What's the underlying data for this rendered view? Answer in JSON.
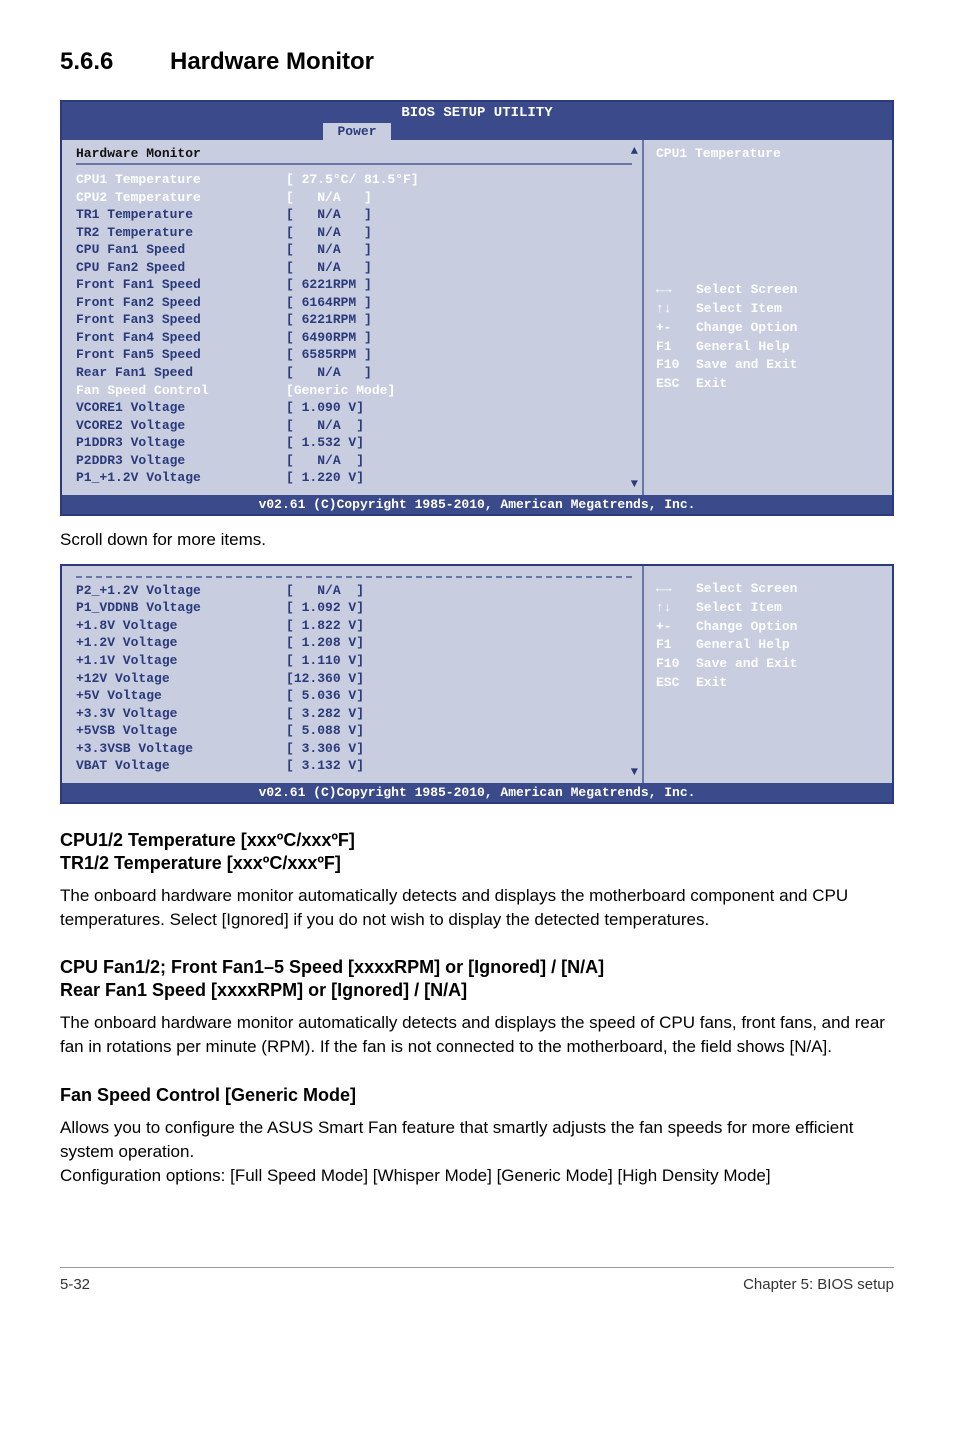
{
  "section": {
    "number": "5.6.6",
    "title": "Hardware Monitor"
  },
  "bios": {
    "title": "BIOS SETUP UTILITY",
    "tab": "Power",
    "hw_header": "Hardware Monitor",
    "help_title": "CPU1 Temperature",
    "rows": [
      {
        "label": "CPU1 Temperature",
        "val": " 27.5°C/ 81.5°F",
        "white": true
      },
      {
        "label": "CPU2 Temperature",
        "val": "   N/A   ",
        "white": true
      },
      {
        "label": "TR1 Temperature",
        "val": "   N/A   ",
        "white": false
      },
      {
        "label": "TR2 Temperature",
        "val": "   N/A   ",
        "white": false
      },
      {
        "label": "CPU Fan1 Speed",
        "val": "   N/A   ",
        "white": false
      },
      {
        "label": "CPU Fan2 Speed",
        "val": "   N/A   ",
        "white": false
      },
      {
        "label": "Front Fan1 Speed",
        "val": " 6221RPM ",
        "white": false
      },
      {
        "label": "Front Fan2 Speed",
        "val": " 6164RPM ",
        "white": false
      },
      {
        "label": "Front Fan3 Speed",
        "val": " 6221RPM ",
        "white": false
      },
      {
        "label": "Front Fan4 Speed",
        "val": " 6490RPM ",
        "white": false
      },
      {
        "label": "Front Fan5 Speed",
        "val": " 6585RPM ",
        "white": false
      },
      {
        "label": "Rear Fan1 Speed",
        "val": "   N/A   ",
        "white": false
      },
      {
        "label": "Fan Speed Control",
        "val": "Generic Mode",
        "white": true
      },
      {
        "label": "VCORE1 Voltage",
        "val": " 1.090 V",
        "white": false
      },
      {
        "label": "VCORE2 Voltage",
        "val": "   N/A  ",
        "white": false
      },
      {
        "label": "P1DDR3 Voltage",
        "val": " 1.532 V",
        "white": false
      },
      {
        "label": "P2DDR3 Voltage",
        "val": "   N/A  ",
        "white": false
      },
      {
        "label": "P1_+1.2V Voltage",
        "val": " 1.220 V",
        "white": false
      }
    ],
    "help_keys": [
      {
        "k": "←→",
        "d": "Select Screen"
      },
      {
        "k": "↑↓",
        "d": "Select Item"
      },
      {
        "k": "+-",
        "d": "Change Option"
      },
      {
        "k": "F1",
        "d": "General Help"
      },
      {
        "k": "F10",
        "d": "Save and Exit"
      },
      {
        "k": "ESC",
        "d": "Exit"
      }
    ],
    "footer": "v02.61 (C)Copyright 1985-2010, American Megatrends, Inc."
  },
  "scroll_note": "Scroll down for more items.",
  "bios2": {
    "rows": [
      {
        "label": "P2_+1.2V Voltage",
        "val": "   N/A  "
      },
      {
        "label": "P1_VDDNB Voltage",
        "val": " 1.092 V"
      },
      {
        "label": "+1.8V Voltage",
        "val": " 1.822 V"
      },
      {
        "label": "+1.2V Voltage",
        "val": " 1.208 V"
      },
      {
        "label": "+1.1V Voltage",
        "val": " 1.110 V"
      },
      {
        "label": "+12V Voltage",
        "val": "12.360 V"
      },
      {
        "label": "+5V Voltage",
        "val": " 5.036 V"
      },
      {
        "label": "+3.3V Voltage",
        "val": " 3.282 V"
      },
      {
        "label": "+5VSB Voltage",
        "val": " 5.088 V"
      },
      {
        "label": "+3.3VSB Voltage",
        "val": " 3.306 V"
      },
      {
        "label": "VBAT Voltage",
        "val": " 3.132 V"
      }
    ],
    "help_keys": [
      {
        "k": "←→",
        "d": "Select Screen"
      },
      {
        "k": "↑↓",
        "d": "Select Item"
      },
      {
        "k": "+-",
        "d": "Change Option"
      },
      {
        "k": "F1",
        "d": "General Help"
      },
      {
        "k": "F10",
        "d": "Save and Exit"
      },
      {
        "k": "ESC",
        "d": "Exit"
      }
    ],
    "footer": "v02.61 (C)Copyright 1985-2010, American Megatrends, Inc."
  },
  "subs": {
    "s1a": "CPU1/2 Temperature [xxxºC/xxxºF]",
    "s1b": "TR1/2 Temperature [xxxºC/xxxºF]",
    "p1": "The onboard hardware monitor automatically detects and displays the motherboard component and CPU temperatures. Select [Ignored] if you do not wish to display the detected temperatures.",
    "s2a": "CPU Fan1/2; Front Fan1–5 Speed [xxxxRPM] or [Ignored] / [N/A]",
    "s2b": "Rear Fan1 Speed [xxxxRPM] or [Ignored] / [N/A]",
    "p2": "The onboard hardware monitor automatically detects and displays the speed of CPU fans, front fans, and rear fan in rotations per minute (RPM). If the fan is not connected to the motherboard, the field shows [N/A].",
    "s3": "Fan Speed Control [Generic Mode]",
    "p3a": "Allows you to configure the ASUS Smart Fan feature that smartly adjusts the fan speeds for more efficient system operation.",
    "p3b": "Configuration options: [Full Speed Mode] [Whisper Mode] [Generic Mode] [High Density Mode]"
  },
  "footer": {
    "left": "5-32",
    "right": "Chapter 5: BIOS setup"
  }
}
